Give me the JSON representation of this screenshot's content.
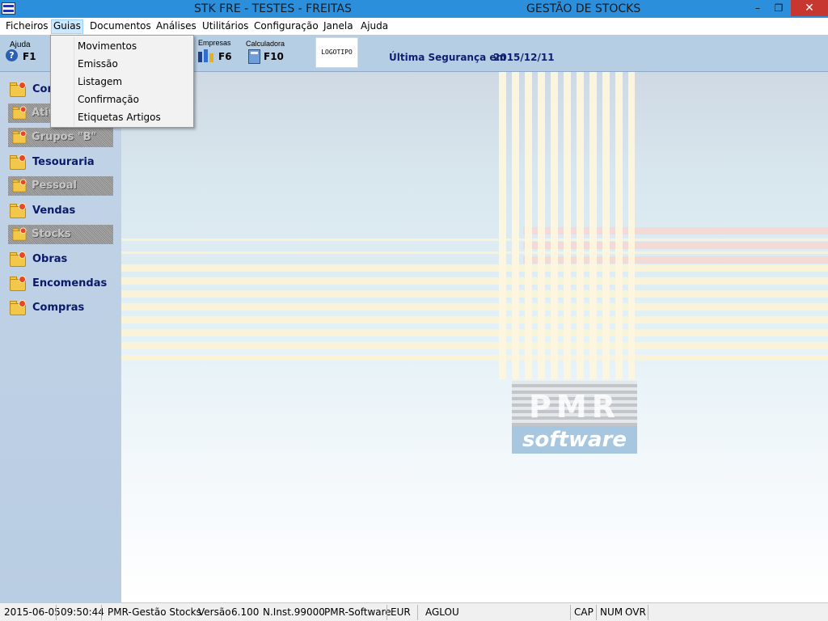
{
  "titlebar": {
    "title": "STK FRE - TESTES - FREITAS",
    "right_title": "GESTÃO DE STOCKS",
    "minimize": "–",
    "restore": "❐",
    "close": "✕"
  },
  "menubar": {
    "items": [
      "Ficheiros",
      "Guias",
      "Documentos",
      "Análises",
      "Utilitários",
      "Configuração",
      "Janela",
      "Ajuda"
    ],
    "active": "Guias"
  },
  "dropdown": {
    "items": [
      "Movimentos",
      "Emissão",
      "Listagem",
      "Confirmação",
      "Etiquetas Artigos"
    ]
  },
  "toolbar": {
    "ajuda_label": "Ajuda",
    "ajuda_key": "F1",
    "empresas_label": "Empresas",
    "empresas_key": "F6",
    "calc_label": "Calculadora",
    "calc_key": "F10",
    "logotipo": "LOGOTIPO",
    "seguranca_label": "Última Segurança em",
    "seguranca_date": "2015/12/11"
  },
  "sidebar": {
    "items": [
      {
        "label": "Com",
        "type": "main"
      },
      {
        "label": "Ativos",
        "type": "sub"
      },
      {
        "label": "Grupos \"B\"",
        "type": "sub"
      },
      {
        "label": "Tesouraria",
        "type": "main"
      },
      {
        "label": "Pessoal",
        "type": "sub"
      },
      {
        "label": "Vendas",
        "type": "main"
      },
      {
        "label": "Stocks",
        "type": "sub"
      },
      {
        "label": "Obras",
        "type": "main"
      },
      {
        "label": "Encomendas",
        "type": "main"
      },
      {
        "label": "Compras",
        "type": "main"
      }
    ]
  },
  "logo": {
    "top": "PMR",
    "bottom": "software"
  },
  "statusbar": {
    "date": "2015-06-05",
    "time": "09:50:44",
    "app": "PMR-Gestão Stocks",
    "version_label": "Versão",
    "version": "6.100",
    "inst": "N.Inst.99000",
    "vendor": "PMR-Software",
    "currency": "EUR",
    "user": "AGLOU",
    "cap": "CAP",
    "num": "NUM",
    "ovr": "OVR"
  },
  "colors": {
    "titlebar": "#2b8fdc",
    "toolbar": "#b6cee4",
    "sidebar": "#bdd0e5",
    "label_text": "#0a1a6a",
    "close_button": "#c7372f"
  }
}
